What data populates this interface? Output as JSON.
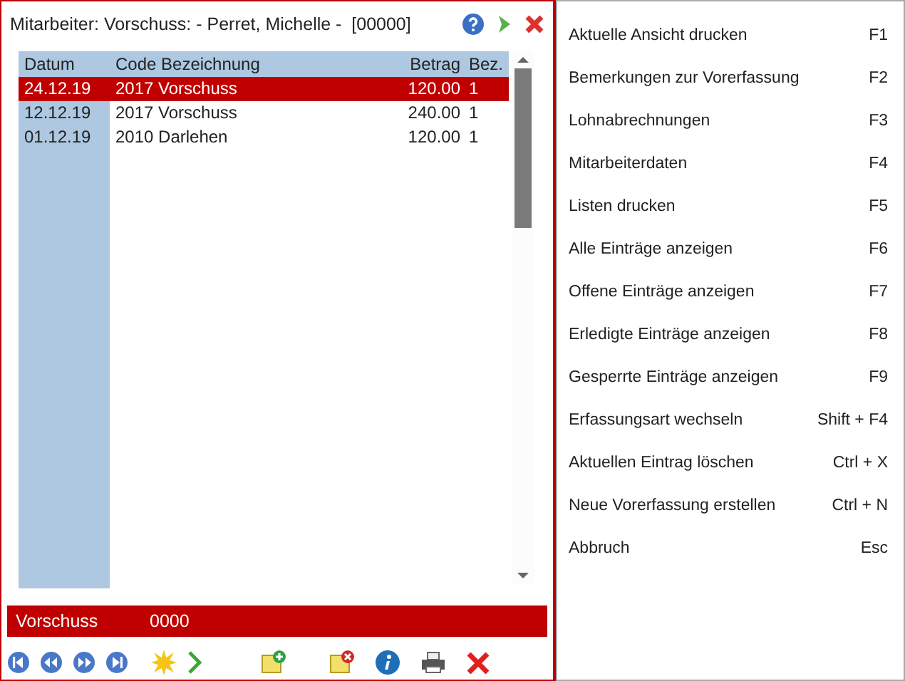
{
  "window": {
    "title": "Mitarbeiter: Vorschuss: - Perret, Michelle -  [00000]"
  },
  "table": {
    "columns": [
      "Datum",
      "Code Bezeichnung",
      "Betrag",
      "Bez."
    ],
    "rows": [
      {
        "cells": [
          "24.12.19",
          "2017 Vorschuss",
          "120.00",
          "1"
        ],
        "selected": true
      },
      {
        "cells": [
          "12.12.19",
          "2017 Vorschuss",
          "240.00",
          "1"
        ],
        "selected": false
      },
      {
        "cells": [
          "01.12.19",
          "2010 Darlehen",
          "120.00",
          "1"
        ],
        "selected": false
      }
    ]
  },
  "footer": {
    "label": "Vorschuss",
    "value": "0000"
  },
  "menu": [
    {
      "label": "Aktuelle Ansicht drucken",
      "shortcut": "F1"
    },
    {
      "label": "Bemerkungen zur Vorerfassung",
      "shortcut": "F2"
    },
    {
      "label": "Lohnabrechnungen",
      "shortcut": "F3"
    },
    {
      "label": "Mitarbeiterdaten",
      "shortcut": "F4"
    },
    {
      "label": "Listen drucken",
      "shortcut": "F5"
    },
    {
      "label": "Alle Einträge anzeigen",
      "shortcut": "F6"
    },
    {
      "label": "Offene Einträge anzeigen",
      "shortcut": "F7"
    },
    {
      "label": "Erledigte Einträge anzeigen",
      "shortcut": "F8"
    },
    {
      "label": "Gesperrte Einträge anzeigen",
      "shortcut": "F9"
    },
    {
      "label": "Erfassungsart wechseln",
      "shortcut": "Shift + F4"
    },
    {
      "label": "Aktuellen Eintrag löschen",
      "shortcut": "Ctrl + X"
    },
    {
      "label": "Neue Vorerfassung erstellen",
      "shortcut": "Ctrl + N"
    },
    {
      "label": "Abbruch",
      "shortcut": "Esc"
    }
  ]
}
